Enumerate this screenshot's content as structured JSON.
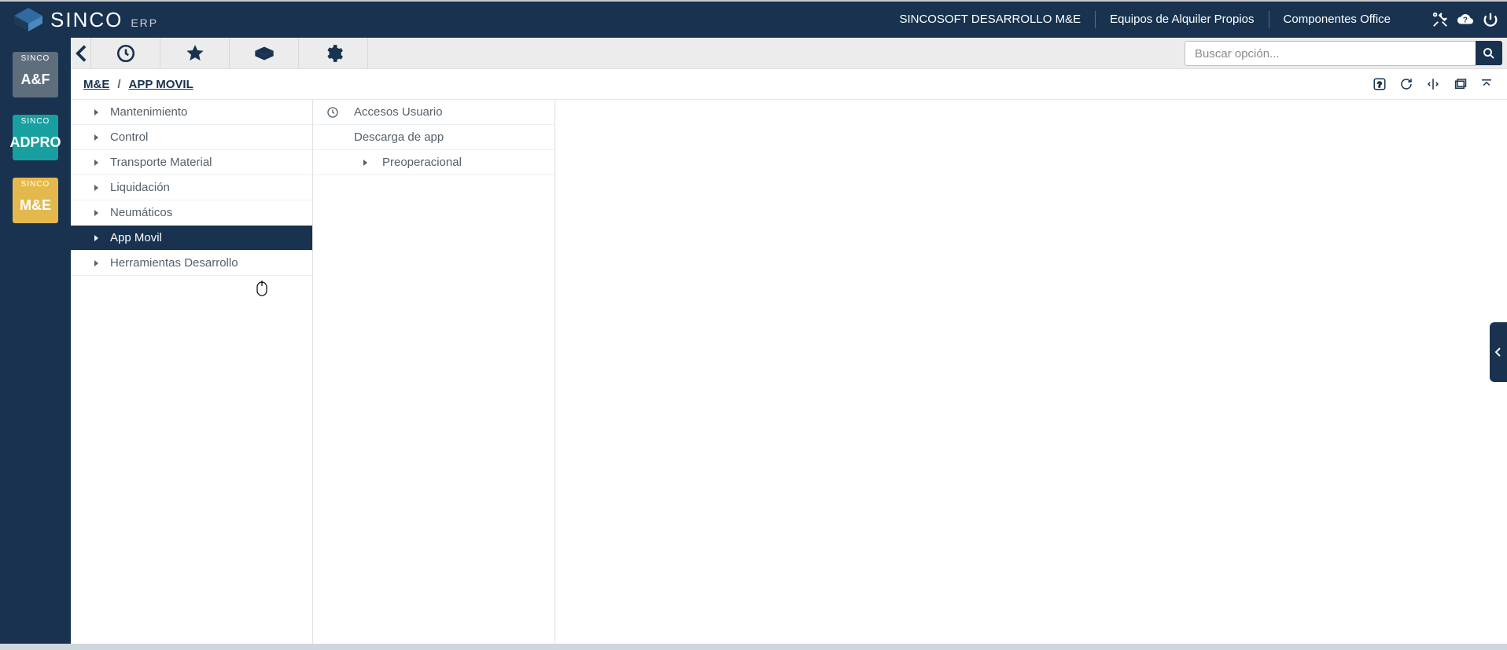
{
  "brand": {
    "name": "SINCO",
    "suffix": "ERP"
  },
  "topbar": {
    "links": [
      "SINCOSOFT DESARROLLO M&E",
      "Equipos de Alquiler Propios",
      "Componentes Office"
    ]
  },
  "toolbar": {
    "search_placeholder": "Buscar opción..."
  },
  "rail": {
    "modules": [
      {
        "top": "SINCO",
        "main": "A&F",
        "cls": "mb-af"
      },
      {
        "top": "SINCO",
        "main": "ADPRO",
        "cls": "mb-adpro"
      },
      {
        "top": "SINCO",
        "main": "M&E",
        "cls": "mb-me"
      }
    ]
  },
  "breadcrumb": {
    "root": "M&E",
    "current": "APP MOVIL"
  },
  "menu": {
    "items": [
      {
        "label": "Mantenimiento"
      },
      {
        "label": "Control"
      },
      {
        "label": "Transporte Material"
      },
      {
        "label": "Liquidación"
      },
      {
        "label": "Neumáticos"
      },
      {
        "label": "App Movil",
        "active": true
      },
      {
        "label": "Herramientas Desarrollo"
      }
    ]
  },
  "submenu": {
    "items": [
      {
        "label": "Accesos Usuario",
        "icon": "clock"
      },
      {
        "label": "Descarga de app",
        "icon": null
      },
      {
        "label": "Preoperacional",
        "icon": "caret"
      }
    ]
  }
}
